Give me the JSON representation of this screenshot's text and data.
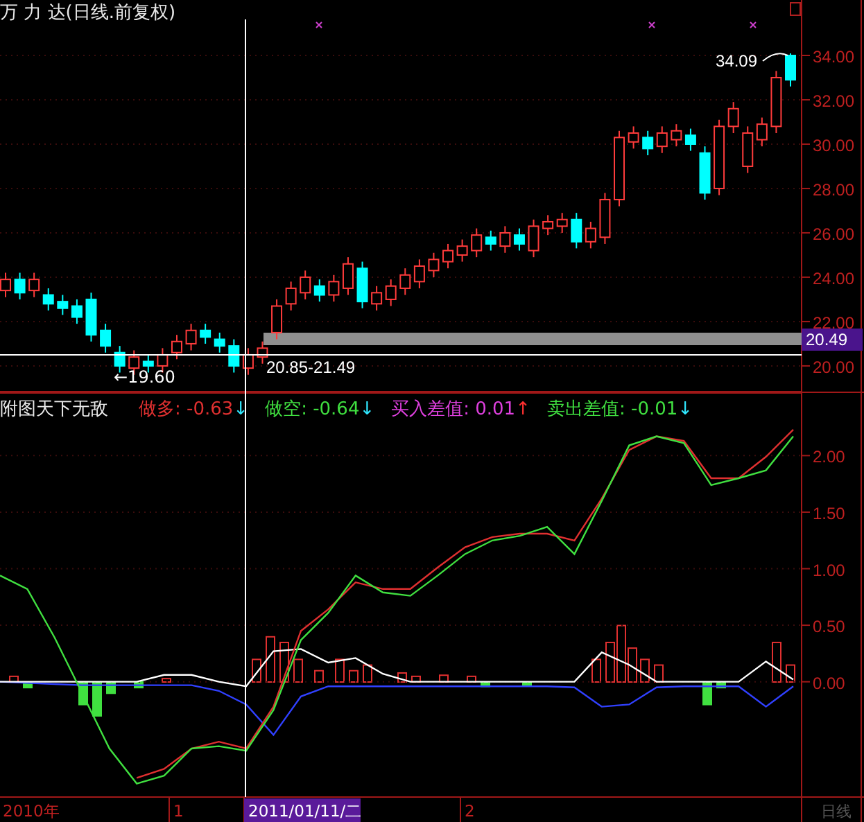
{
  "chart_title": "万 力 达(日线.前复权)",
  "price_chart": {
    "chart_data": {
      "type": "candlestick",
      "ylim": [
        18.81,
        36.5
      ],
      "grid": true,
      "yticks": [
        {
          "value": 34,
          "label": "34.00"
        },
        {
          "value": 32,
          "label": "32.00"
        },
        {
          "value": 30,
          "label": "30.00"
        },
        {
          "value": 28,
          "label": "28.00"
        },
        {
          "value": 26,
          "label": "26.00"
        },
        {
          "value": 24,
          "label": "24.00"
        },
        {
          "value": 22,
          "label": "22.00"
        },
        {
          "value": 20,
          "label": "20.00"
        }
      ],
      "ohlc": [
        [
          23.4,
          24.2,
          23.1,
          23.9
        ],
        [
          23.9,
          24.2,
          23.0,
          23.3
        ],
        [
          23.4,
          24.2,
          23.1,
          23.9
        ],
        [
          23.2,
          23.5,
          22.5,
          22.8
        ],
        [
          22.9,
          23.2,
          22.3,
          22.6
        ],
        [
          22.7,
          23.0,
          21.9,
          22.2
        ],
        [
          23.0,
          23.3,
          21.1,
          21.4
        ],
        [
          21.6,
          21.9,
          20.6,
          20.9
        ],
        [
          20.6,
          20.9,
          19.7,
          20.0
        ],
        [
          19.9,
          20.7,
          19.6,
          20.4
        ],
        [
          20.2,
          20.5,
          19.7,
          20.0
        ],
        [
          20.0,
          20.8,
          19.7,
          20.5
        ],
        [
          20.6,
          21.4,
          20.3,
          21.1
        ],
        [
          21.0,
          21.9,
          20.7,
          21.6
        ],
        [
          21.6,
          21.9,
          21.0,
          21.3
        ],
        [
          21.2,
          21.5,
          20.6,
          20.9
        ],
        [
          20.9,
          21.2,
          19.7,
          20.0
        ],
        [
          19.9,
          20.8,
          19.6,
          20.5
        ],
        [
          20.4,
          21.1,
          20.1,
          20.8
        ],
        [
          21.5,
          23.0,
          21.2,
          22.7
        ],
        [
          22.8,
          23.8,
          22.5,
          23.5
        ],
        [
          23.3,
          24.3,
          23.0,
          24.0
        ],
        [
          23.6,
          23.9,
          22.9,
          23.2
        ],
        [
          23.2,
          24.1,
          22.9,
          23.8
        ],
        [
          23.5,
          24.9,
          23.2,
          24.6
        ],
        [
          24.4,
          24.7,
          22.6,
          22.9
        ],
        [
          22.8,
          23.6,
          22.5,
          23.3
        ],
        [
          23.0,
          23.9,
          22.7,
          23.6
        ],
        [
          23.5,
          24.4,
          23.2,
          24.1
        ],
        [
          23.8,
          24.8,
          23.5,
          24.5
        ],
        [
          24.3,
          25.1,
          24.0,
          24.8
        ],
        [
          24.7,
          25.5,
          24.4,
          25.2
        ],
        [
          25.0,
          25.7,
          24.7,
          25.4
        ],
        [
          25.2,
          26.2,
          24.9,
          25.9
        ],
        [
          25.8,
          26.1,
          25.2,
          25.5
        ],
        [
          25.4,
          26.3,
          25.1,
          26.0
        ],
        [
          25.9,
          26.2,
          25.2,
          25.5
        ],
        [
          25.2,
          26.6,
          24.9,
          26.3
        ],
        [
          26.2,
          26.8,
          25.9,
          26.5
        ],
        [
          26.3,
          26.9,
          26.0,
          26.6
        ],
        [
          26.6,
          26.9,
          25.3,
          25.6
        ],
        [
          25.6,
          26.5,
          25.3,
          26.2
        ],
        [
          25.8,
          27.8,
          25.5,
          27.5
        ],
        [
          27.5,
          30.6,
          27.2,
          30.3
        ],
        [
          30.1,
          30.8,
          29.8,
          30.5
        ],
        [
          30.3,
          30.6,
          29.5,
          29.8
        ],
        [
          29.9,
          30.8,
          29.6,
          30.5
        ],
        [
          30.2,
          30.9,
          29.9,
          30.6
        ],
        [
          30.4,
          30.7,
          29.7,
          30.0
        ],
        [
          29.6,
          29.9,
          27.5,
          27.8
        ],
        [
          28.0,
          31.1,
          27.7,
          30.8
        ],
        [
          30.8,
          31.9,
          30.5,
          31.6
        ],
        [
          29.0,
          30.8,
          28.7,
          30.5
        ],
        [
          30.2,
          31.2,
          29.9,
          30.9
        ],
        [
          30.8,
          33.3,
          30.5,
          33.0
        ],
        [
          34.0,
          34.09,
          32.6,
          32.9
        ]
      ]
    },
    "current_price": "20.49"
  },
  "price_annotations": {
    "high": "34.09",
    "low": "←19.60",
    "range": "20.85-21.49"
  },
  "indicator": {
    "name": "附图天下无敌",
    "values": [
      {
        "label": "做多: -0.63",
        "color": "#e03030",
        "arrow": {
          "text": "↓",
          "color": "#30e8ff"
        }
      },
      {
        "label": "做空: -0.64",
        "color": "#40e040",
        "arrow": {
          "text": "↓",
          "color": "#30e8ff"
        }
      },
      {
        "label": "买入差值: 0.01",
        "color": "#e040e0",
        "arrow": {
          "text": "↑",
          "color": "#ff3030"
        }
      },
      {
        "label": "卖出差值: -0.01",
        "color": "#40e040",
        "arrow": {
          "text": "↓",
          "color": "#30e8ff"
        }
      }
    ],
    "chart_data": {
      "type": "line",
      "ylim": [
        -1.24,
        2.56
      ],
      "grid": true,
      "yticks": [
        {
          "value": 2,
          "label": "2.00"
        },
        {
          "value": 1.5,
          "label": "1.50"
        },
        {
          "value": 1,
          "label": "1.00"
        },
        {
          "value": 0.5,
          "label": "0.50"
        },
        {
          "value": 0,
          "label": "0.00"
        }
      ],
      "series": [
        {
          "color": "#3040ff",
          "values": [
            0,
            -0.01,
            -0.02,
            -0.03,
            -0.03,
            -0.03,
            -0.03,
            -0.03,
            -0.08,
            -0.2,
            -0.47,
            -0.13,
            -0.04,
            -0.04,
            -0.04,
            -0.04,
            -0.04,
            -0.04,
            -0.04,
            -0.04,
            -0.04,
            -0.05,
            -0.22,
            -0.2,
            -0.05,
            -0.04,
            -0.04,
            -0.04,
            -0.22,
            -0.04
          ]
        },
        {
          "color": "#ffffff",
          "values": [
            0,
            0,
            0,
            0,
            0,
            0,
            0.06,
            0.06,
            0,
            -0.04,
            0.27,
            0.29,
            0.17,
            0.21,
            0.07,
            0,
            0,
            0,
            0,
            0,
            0,
            0,
            0.26,
            0.15,
            0,
            0,
            0,
            0,
            0.18,
            0.02
          ]
        },
        {
          "color": "#e03030",
          "values": [
            null,
            null,
            null,
            null,
            null,
            -0.85,
            -0.77,
            -0.59,
            -0.53,
            -0.59,
            -0.22,
            0.45,
            0.64,
            0.88,
            0.82,
            0.82,
            1.01,
            1.19,
            1.28,
            1.31,
            1.31,
            1.25,
            1.62,
            2.05,
            2.17,
            2.13,
            1.8,
            1.8,
            1.99,
            2.23
          ]
        },
        {
          "color": "#40e040",
          "values": [
            0.94,
            0.82,
            0.39,
            -0.1,
            -0.59,
            -0.9,
            -0.83,
            -0.59,
            -0.57,
            -0.61,
            -0.25,
            0.37,
            0.61,
            0.94,
            0.79,
            0.76,
            0.94,
            1.13,
            1.25,
            1.29,
            1.37,
            1.13,
            1.6,
            2.09,
            2.17,
            2.11,
            1.74,
            1.8,
            1.87,
            2.17
          ]
        }
      ]
    }
  },
  "time_axis": {
    "labels": [
      {
        "text": "2010年",
        "selected": false
      },
      {
        "text": "1",
        "selected": false
      },
      {
        "text": "2011/01/11/二",
        "selected": true
      },
      {
        "text": "2",
        "selected": false
      }
    ]
  },
  "period": "日线"
}
